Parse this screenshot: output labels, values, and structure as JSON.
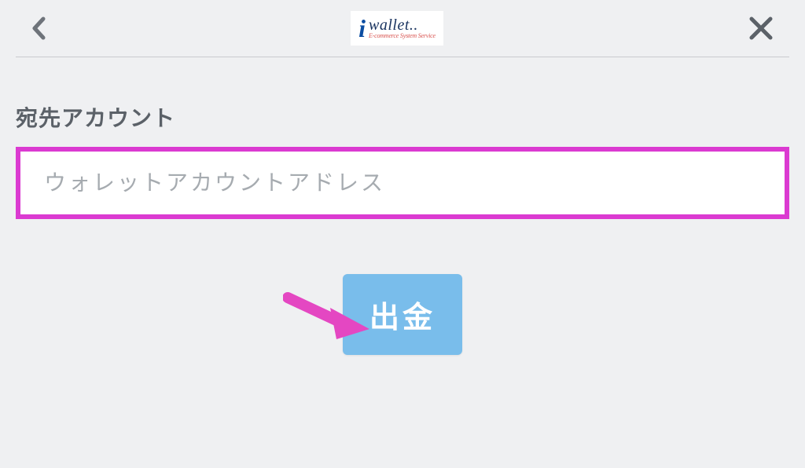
{
  "header": {
    "logo_main": "wallet..",
    "logo_tagline": "E-commerce System Service"
  },
  "form": {
    "destination_label": "宛先アカウント",
    "wallet_placeholder": "ウォレットアカウントアドレス",
    "wallet_value": ""
  },
  "actions": {
    "withdraw_label": "出金"
  },
  "annotation": {
    "highlight_color": "#db3ad1",
    "arrow_color": "#e447c2"
  }
}
